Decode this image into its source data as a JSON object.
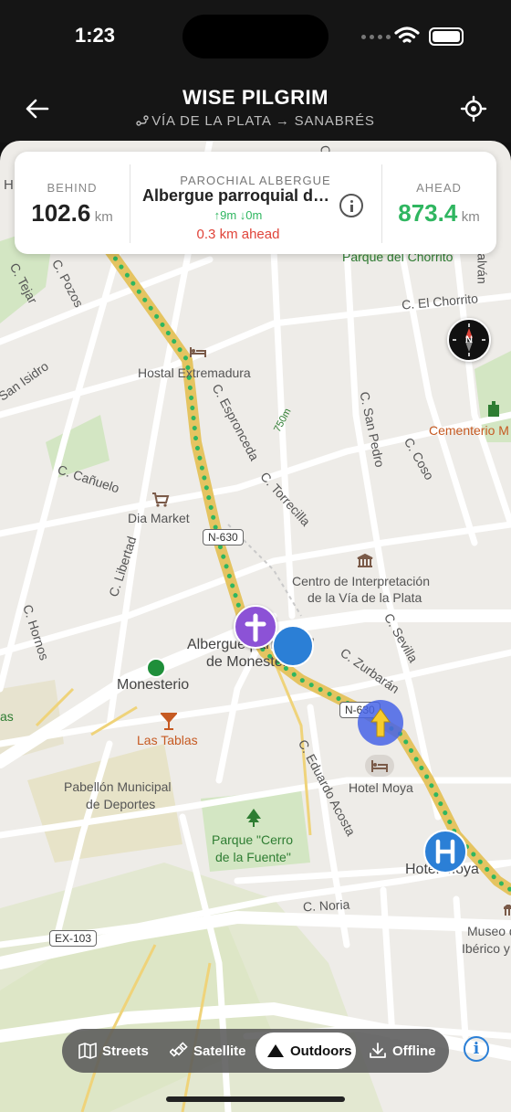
{
  "status_bar": {
    "time": "1:23"
  },
  "header": {
    "title": "WISE PILGRIM",
    "subtitle": "VÍA DE LA PLATA → SANABRÉS"
  },
  "card": {
    "behind_label": "BEHIND",
    "behind_value": "102.6",
    "behind_unit": "km",
    "poi_type": "PAROCHIAL ALBERGUE",
    "poi_name": "Albergue parroquial de Monesterio",
    "elevation": "↑9m ↓0m",
    "distance_ahead": "0.3 km ahead",
    "ahead_label": "AHEAD",
    "ahead_value": "873.4",
    "ahead_unit": "km"
  },
  "map": {
    "labels": {
      "parque_chorrito": "Parque del Chorrito",
      "c_el_chorrito": "C. El Chorrito",
      "hostal_extremadura": "Hostal Extremadura",
      "c_tejar": "C. Tejar",
      "c_pozos": "C. Pozos",
      "san_isidro": "San Isidro",
      "c_espronceda": "C. Espronceda",
      "c_san_pedro": "C. San Pedro",
      "c_coso": "C. Coso",
      "cementerio": "Cementerio M",
      "c_canuelo": "C. Cañuelo",
      "c_torrecilla": "C. Torrecilla",
      "dia_market": "Dia Market",
      "c_libertad": "C. Libertad",
      "centro_interp_1": "Centro de Interpretación",
      "centro_interp_2": "de la Vía de la Plata",
      "c_hornos": "C. Hornos",
      "c_sevilla": "C. Sevilla",
      "albergue_1": "Albergue parroquial",
      "albergue_2": "de Monesterio",
      "c_zurbaran": "C. Zurbarán",
      "monesterio": "Monesterio",
      "las_tablas": "Las Tablas",
      "c_eduardo_acosta": "C. Eduardo Acosta",
      "hotel_moya_1": "Hotel Moya",
      "pabellon_1": "Pabellón Municipal",
      "pabellon_2": "de Deportes",
      "parque_cerro_1": "Parque \"Cerro",
      "parque_cerro_2": "de la Fuente\"",
      "hotel_moya_2": "Hotel Moya",
      "c_noria": "C. Noria",
      "museo_1": "Museo d",
      "museo_2": "Ibérico y",
      "galvan": "alván",
      "distance_marker": "750m",
      "edge_h": "H",
      "edge_c": "C.",
      "edge_as": "as"
    },
    "road_badges": {
      "n630_a": "N-630",
      "n630_b": "N-630",
      "ex103": "EX-103"
    },
    "compass_letter": "N"
  },
  "modes": {
    "streets": "Streets",
    "satellite": "Satellite",
    "outdoors": "Outdoors",
    "offline": "Offline",
    "active": "Outdoors"
  },
  "info_button": "i",
  "colors": {
    "route_green": "#2fb660",
    "route_line": "#e5c461",
    "albergue_purple": "#8c52d6",
    "hotel_blue": "#2b7fd6",
    "ahead_red": "#e0443a"
  }
}
